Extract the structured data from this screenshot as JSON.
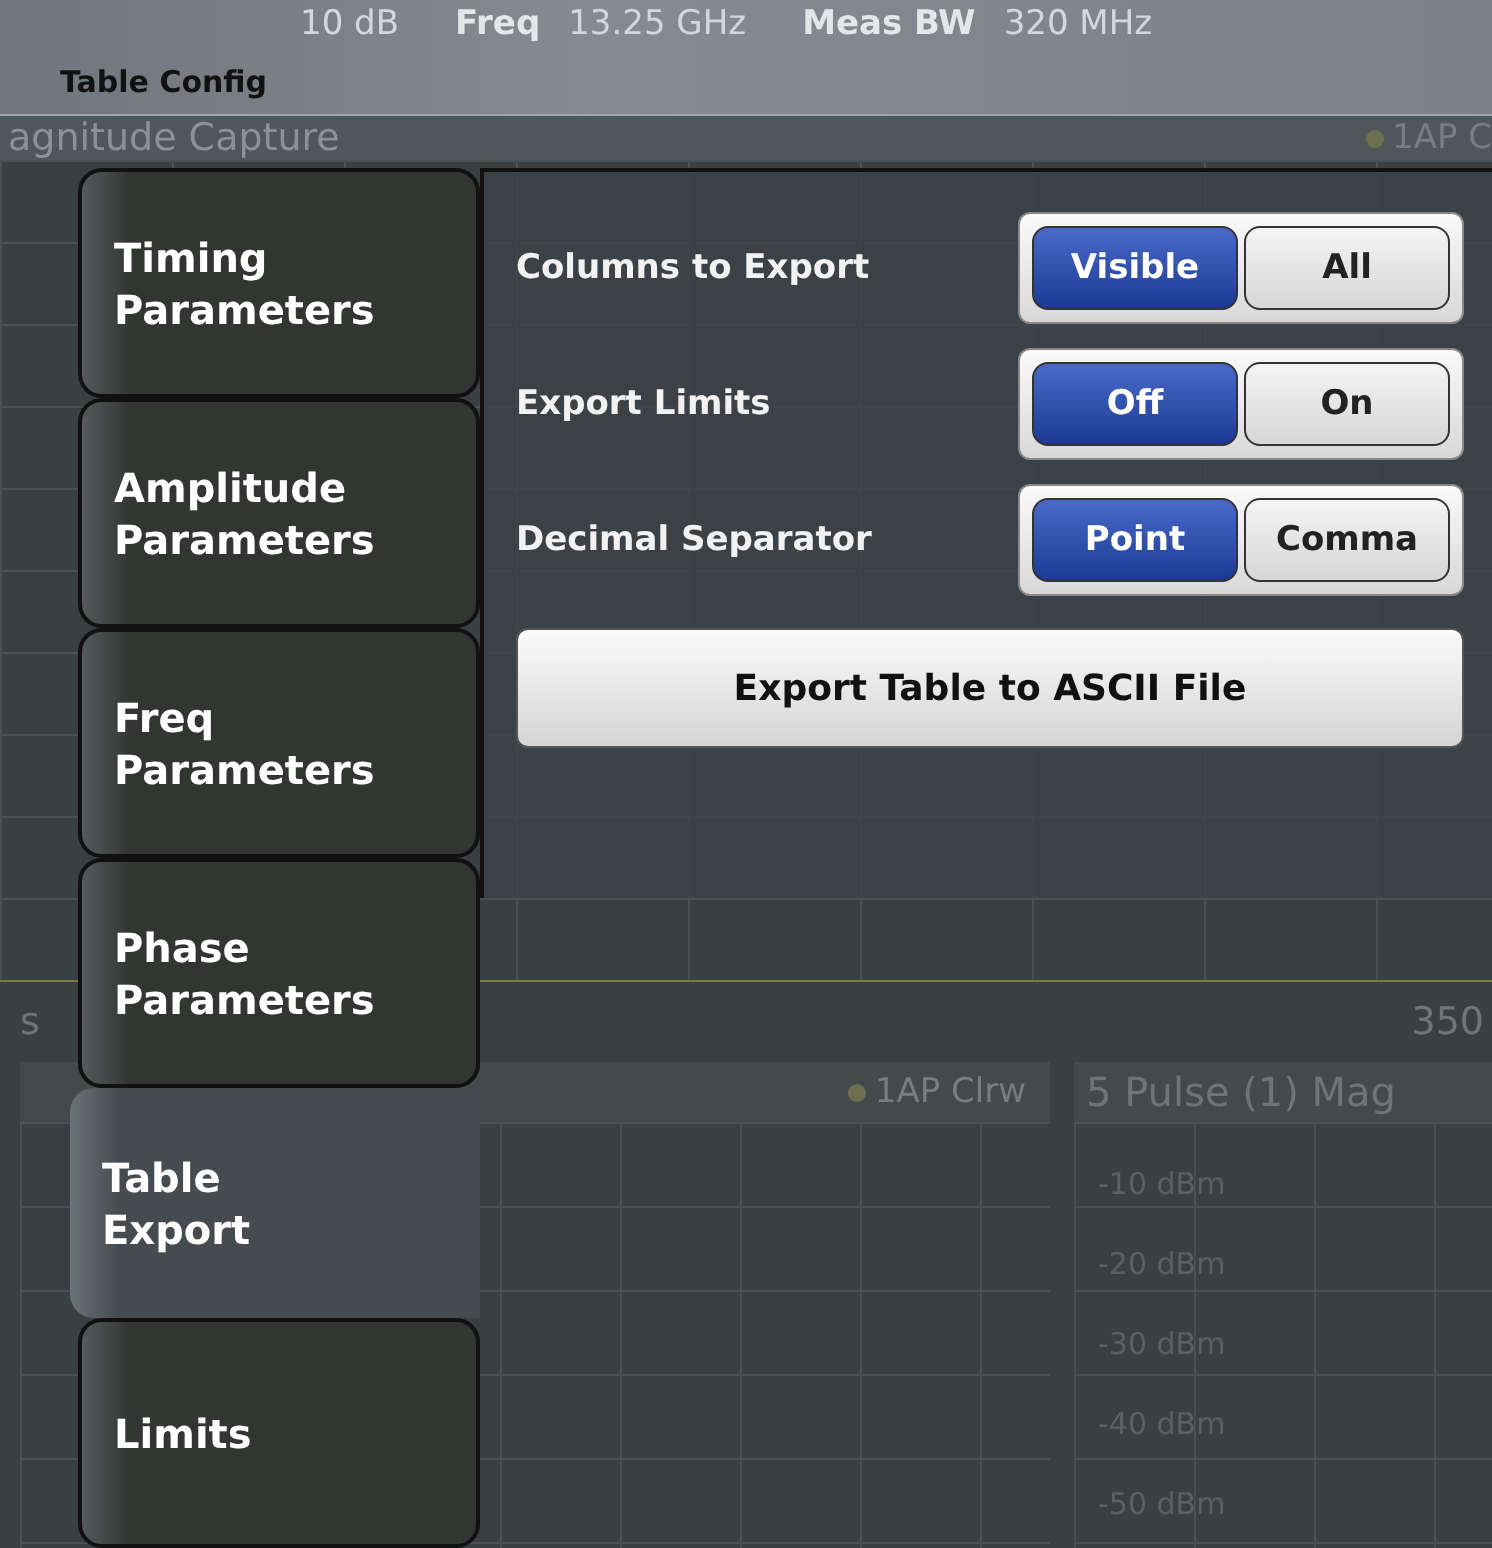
{
  "header": {
    "title": "Table Config",
    "attenuation": "10 dB",
    "items": [
      {
        "label": "Freq",
        "value": "13.25 GHz"
      },
      {
        "label": "Meas BW",
        "value": "320 MHz"
      }
    ]
  },
  "background": {
    "capture_title": "agnitude Capture",
    "capture_trace": "1AP C",
    "axis_unit": "s",
    "axis_value": "350",
    "lower_left_trace": "1AP Clrw",
    "lower_right_title": "5 Pulse (1) Mag",
    "y_labels": [
      "-10 dBm",
      "-20 dBm",
      "-30 dBm",
      "-40 dBm",
      "-50 dBm"
    ]
  },
  "tabs": [
    {
      "label": "Timing Parameters",
      "selected": false
    },
    {
      "label": "Amplitude Parameters",
      "selected": false
    },
    {
      "label": "Freq Parameters",
      "selected": false
    },
    {
      "label": "Phase Parameters",
      "selected": false
    },
    {
      "label": "Table Export",
      "selected": true
    },
    {
      "label": "Limits",
      "selected": false
    }
  ],
  "settings": [
    {
      "label": "Columns to Export",
      "options": [
        {
          "label": "Visible",
          "selected": true
        },
        {
          "label": "All",
          "selected": false
        }
      ]
    },
    {
      "label": "Export Limits",
      "options": [
        {
          "label": "Off",
          "selected": true
        },
        {
          "label": "On",
          "selected": false
        }
      ]
    },
    {
      "label": "Decimal Separator",
      "options": [
        {
          "label": "Point",
          "selected": true
        },
        {
          "label": "Comma",
          "selected": false
        }
      ]
    }
  ],
  "export_button": "Export Table to ASCII File"
}
